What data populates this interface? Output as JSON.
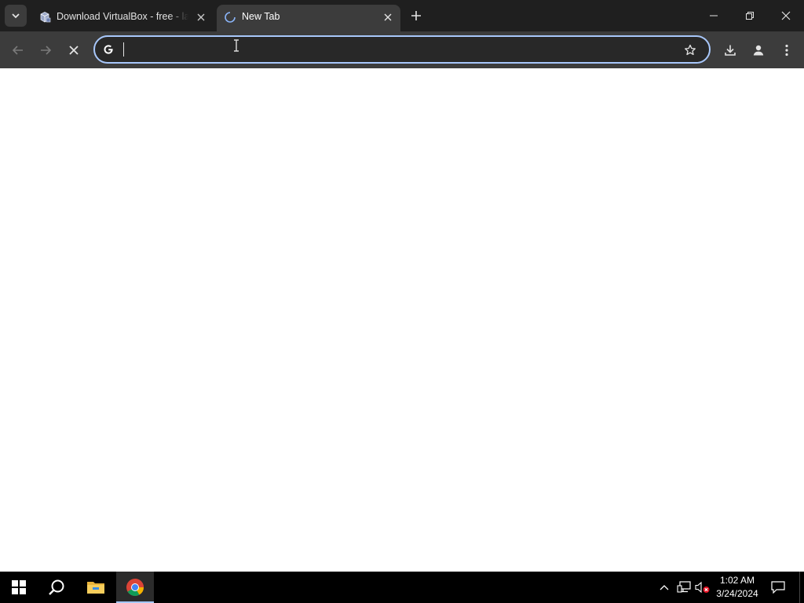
{
  "browser": {
    "tabs": [
      {
        "title": "Download VirtualBox - free - lat",
        "favicon": "virtualbox-icon",
        "active": false
      },
      {
        "title": "New Tab",
        "favicon": "loading-spinner-icon",
        "active": true
      }
    ],
    "omnibox": {
      "value": "",
      "placeholder": ""
    },
    "window_controls": [
      "minimize",
      "restore",
      "close"
    ]
  },
  "taskbar": {
    "pinned": [
      "start-icon",
      "search-icon",
      "file-explorer-icon",
      "chrome-icon"
    ],
    "tray": [
      "chevron-up-icon",
      "network-icon",
      "volume-muted-icon"
    ],
    "clock": {
      "time": "1:02 AM",
      "date": "3/24/2024"
    }
  },
  "colors": {
    "tabstrip": "#1f1f1f",
    "toolbar": "#3c3c3c",
    "omnibox_border": "#a8c7fa",
    "taskbar": "#000000"
  }
}
